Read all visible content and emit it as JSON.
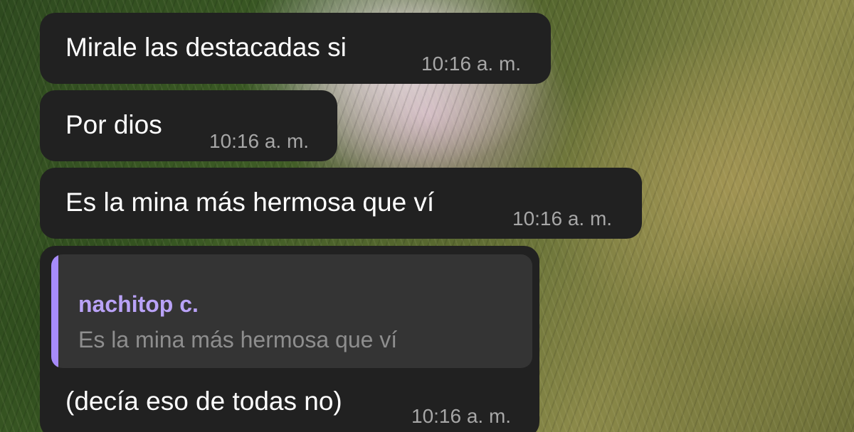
{
  "messages": [
    {
      "text": "Mirale las destacadas si",
      "time": "10:16 a. m."
    },
    {
      "text": "Por dios",
      "time": "10:16 a. m."
    },
    {
      "text": "Es la mina más hermosa que ví",
      "time": "10:16 a. m."
    },
    {
      "reply": {
        "author": "nachitop c.",
        "text": "Es la mina más hermosa que ví"
      },
      "text": "(decía eso de todas no)",
      "time": "10:16 a. m."
    }
  ],
  "colors": {
    "bubble": "#212121",
    "reply_box": "#343434",
    "reply_accent": "#a78bfa",
    "reply_author": "#b9a2f7",
    "timestamp": "#a7a7a7"
  }
}
